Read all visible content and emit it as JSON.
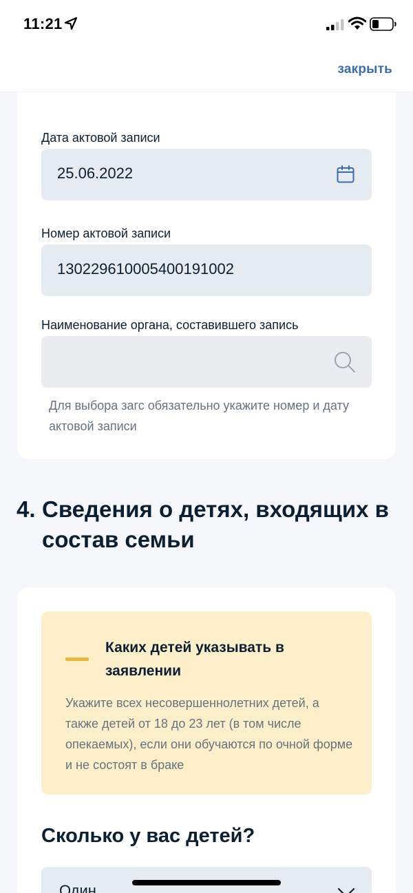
{
  "status_bar": {
    "time": "11:21",
    "icons": [
      "location-arrow-icon",
      "cellular-signal-icon",
      "wifi-icon",
      "battery-icon"
    ]
  },
  "top_bar": {
    "close_label": "закрыть"
  },
  "registration_card": {
    "date_field": {
      "label": "Дата актовой записи",
      "value": "25.06.2022",
      "icon": "calendar-icon"
    },
    "number_field": {
      "label": "Номер актовой записи",
      "value": "130229610005400191002"
    },
    "authority_field": {
      "label": "Наименование органа, составившего запись",
      "value": "",
      "icon": "search-icon",
      "hint": "Для выбора загс обязательно укажите номер и дату актовой записи"
    }
  },
  "section": {
    "number": "4.",
    "title": "Сведения о детях, входящих в состав семьи"
  },
  "children_card": {
    "notice": {
      "title": "Каких детей указывать в заявлении",
      "text": "Укажите всех несовершеннолетних детей, а также детей от 18 до 23 лет (в том числе опекаемых), если они обучаются по очной форме и не состоят в браке"
    },
    "question": "Сколько у вас детей?",
    "children_select": {
      "value": "Один",
      "icon": "chevron-down-icon"
    }
  },
  "colors": {
    "accent": "#3a6bb0",
    "page_background": "#f5f7fa",
    "field_background": "#e6ebf1",
    "notice_background": "#fcefc9",
    "notice_accent": "#eab53c",
    "hint_text": "#66727f",
    "main_text": "#0b1f33"
  }
}
